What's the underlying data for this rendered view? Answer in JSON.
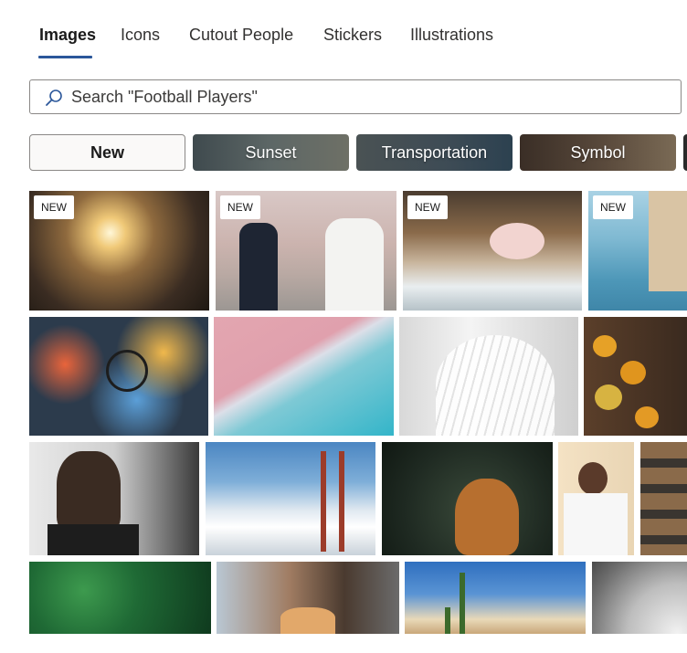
{
  "tabs": [
    {
      "label": "Images",
      "active": true
    },
    {
      "label": "Icons",
      "active": false
    },
    {
      "label": "Cutout People",
      "active": false
    },
    {
      "label": "Stickers",
      "active": false
    },
    {
      "label": "Illustrations",
      "active": false
    }
  ],
  "search": {
    "placeholder": "Search \"Football Players\"",
    "value": ""
  },
  "chips": [
    {
      "label": "New"
    },
    {
      "label": "Sunset"
    },
    {
      "label": "Transportation"
    },
    {
      "label": "Symbol"
    }
  ],
  "badge_label": "NEW",
  "colors": {
    "accent": "#2b579a",
    "border": "#8a8886"
  }
}
